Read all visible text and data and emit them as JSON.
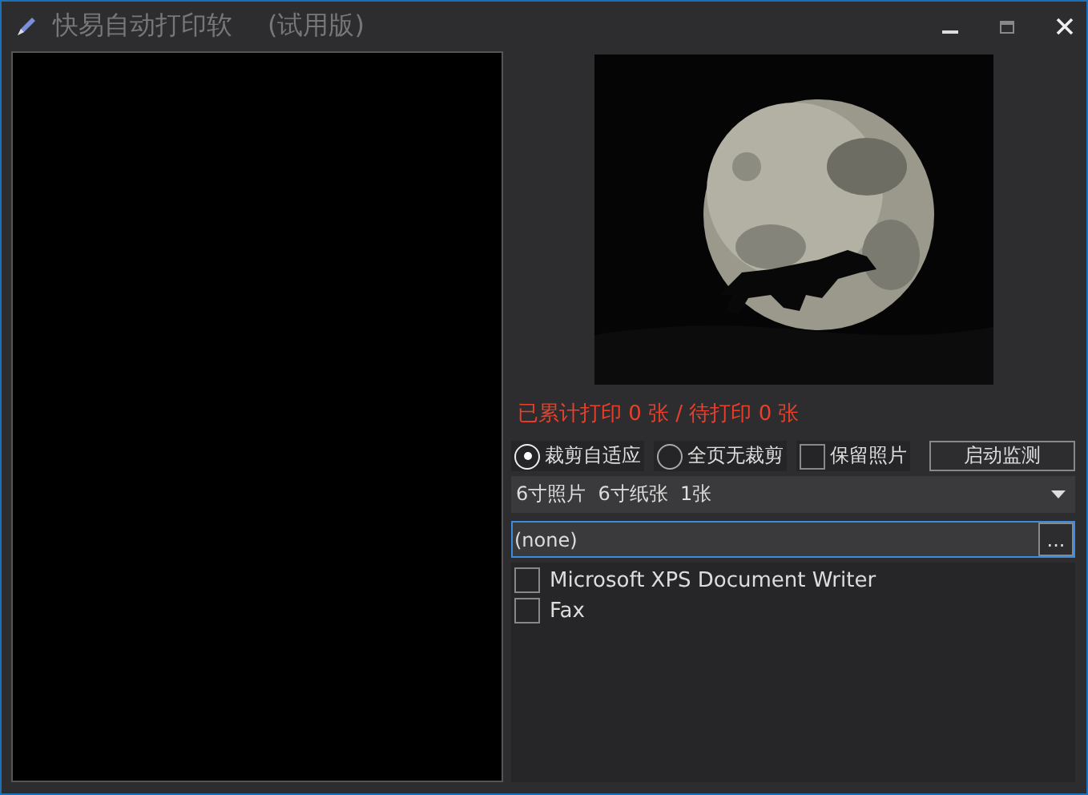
{
  "window": {
    "title": "快易自动打印软",
    "edition": "(试用版)"
  },
  "counter": "已累计打印 0 张 / 待打印 0 张",
  "crop_options": [
    {
      "label": "裁剪自适应",
      "selected": true
    },
    {
      "label": "全页无裁剪",
      "selected": false
    }
  ],
  "keep_photo": {
    "label": "保留照片",
    "checked": false
  },
  "start_button": "启动监测",
  "size_select": {
    "value": "6寸照片  6寸纸张  1张"
  },
  "path_field": {
    "value": "(none)",
    "browse": "..."
  },
  "printers": [
    {
      "name": "Microsoft XPS Document Writer",
      "checked": false
    },
    {
      "name": "Fax",
      "checked": false
    }
  ]
}
